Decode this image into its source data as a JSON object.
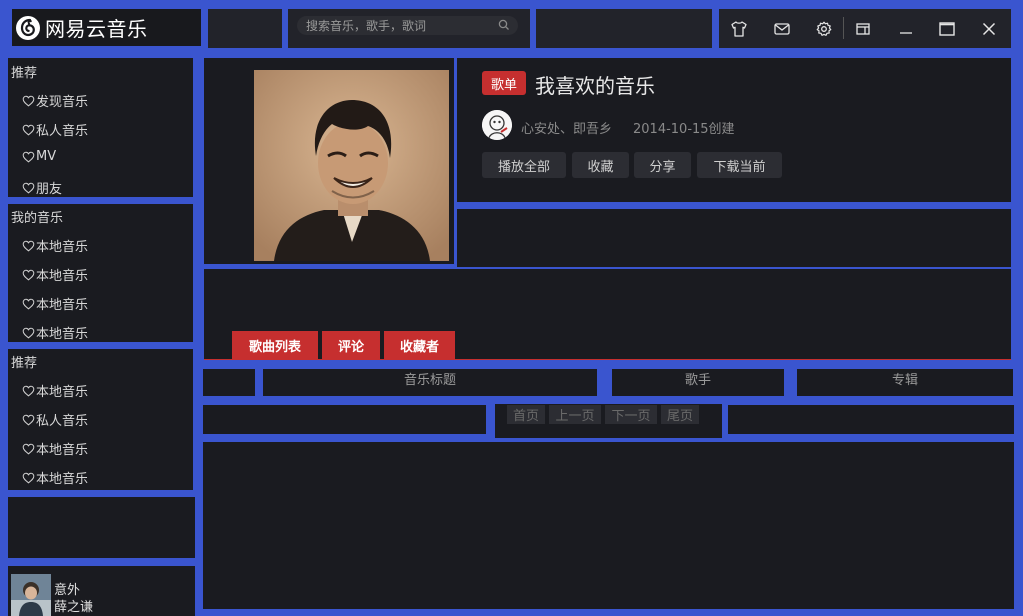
{
  "app": {
    "logo_text": "网易云音乐"
  },
  "search": {
    "placeholder": "搜索音乐，歌手，歌词"
  },
  "window_controls": [
    "skin-icon",
    "mail-icon",
    "settings-icon",
    "mini-mode-icon",
    "minimize-icon",
    "maximize-icon",
    "close-icon"
  ],
  "sidebar": {
    "groups": [
      {
        "title": "推荐",
        "items": [
          "发现音乐",
          "私人音乐",
          "MV",
          "朋友"
        ]
      },
      {
        "title": "我的音乐",
        "items": [
          "本地音乐",
          "本地音乐",
          "本地音乐",
          "本地音乐"
        ]
      },
      {
        "title": "推荐",
        "items": [
          "本地音乐",
          "私人音乐",
          "本地音乐",
          "本地音乐"
        ]
      }
    ]
  },
  "player": {
    "song": "意外",
    "artist": "薛之谦"
  },
  "playlist": {
    "tag": "歌单",
    "title": "我喜欢的音乐",
    "creator": "心安处、即吾乡",
    "created": "2014-10-15创建",
    "actions": [
      "播放全部",
      "收藏",
      "分享",
      "下载当前"
    ]
  },
  "tabs": [
    "歌曲列表",
    "评论",
    "收藏者"
  ],
  "columns": [
    "",
    "音乐标题",
    "歌手",
    "专辑"
  ],
  "pager": [
    "首页",
    "上一页",
    "下一页",
    "尾页"
  ],
  "colors": {
    "accent": "#c62f2f",
    "frame": "#3a55cf",
    "panel": "#1a1b20"
  }
}
